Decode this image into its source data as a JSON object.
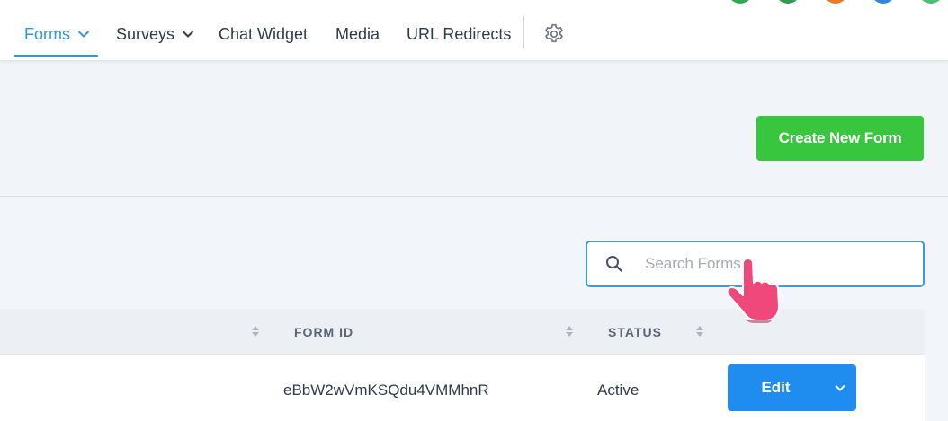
{
  "nav": {
    "items": [
      {
        "label": "Forms",
        "active": true,
        "dropdown": true
      },
      {
        "label": "Surveys",
        "active": false,
        "dropdown": true
      },
      {
        "label": "Chat Widget",
        "active": false,
        "dropdown": false
      },
      {
        "label": "Media",
        "active": false,
        "dropdown": false
      },
      {
        "label": "URL Redirects",
        "active": false,
        "dropdown": false
      }
    ],
    "settings_icon": "gear-icon",
    "avatar_colors": [
      "#2eaa52",
      "#2e9a52",
      "#f07a20",
      "#2e86de",
      "#4bbf73"
    ]
  },
  "header": {
    "create_button_label": "Create New Form",
    "create_button_color": "#38c63f"
  },
  "search": {
    "placeholder": "Search Forms",
    "value": "",
    "icon": "search-icon"
  },
  "table": {
    "columns": [
      "FORM ID",
      "STATUS"
    ],
    "rows": [
      {
        "form_id": "eBbW2wVmKSQdu4VMMhnR",
        "status": "Active",
        "action_label": "Edit"
      }
    ]
  },
  "colors": {
    "accent": "#2d9ad7",
    "edit_button": "#1f8df0",
    "pointer": "#f0487a"
  }
}
